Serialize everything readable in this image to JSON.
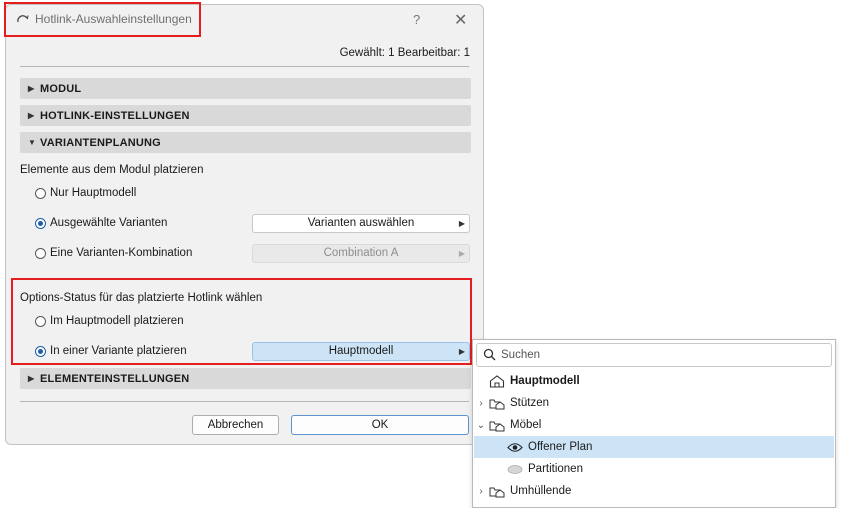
{
  "dialog": {
    "title": "Hotlink-Auswahleinstellungen",
    "help": "?",
    "close": "✕",
    "selection_status": "Gewählt: 1 Bearbeitbar: 1",
    "sections": {
      "modul": "MODUL",
      "hotlink_settings": "HOTLINK-EINSTELLUNGEN",
      "variant_planning": "VARIANTENPLANUNG",
      "element_settings": "ELEMENTEINSTELLUNGEN"
    },
    "place_elements": {
      "label": "Elemente aus dem Modul platzieren",
      "options": [
        {
          "label": "Nur Hauptmodell",
          "selected": false
        },
        {
          "label": "Ausgewählte Varianten",
          "selected": true,
          "button": "Varianten auswählen"
        },
        {
          "label": "Eine Varianten-Kombination",
          "selected": false,
          "button": "Combination A"
        }
      ]
    },
    "options_status": {
      "label": "Options-Status für das platzierte Hotlink wählen",
      "options": [
        {
          "label": "Im Hauptmodell platzieren",
          "selected": false
        },
        {
          "label": "In einer Variante platzieren",
          "selected": true,
          "button": "Hauptmodell"
        }
      ]
    },
    "buttons": {
      "cancel": "Abbrechen",
      "ok": "OK"
    }
  },
  "dropdown": {
    "search_placeholder": "Suchen",
    "items": [
      {
        "label": "Hauptmodell",
        "icon": "house-icon",
        "bold": true
      },
      {
        "label": "Stützen",
        "icon": "variant-set-icon",
        "expanded": false
      },
      {
        "label": "Möbel",
        "icon": "variant-set-icon",
        "expanded": true
      },
      {
        "label": "Offener Plan",
        "icon": "eye-icon",
        "selected": true
      },
      {
        "label": "Partitionen",
        "icon": "hidden-eye-icon"
      },
      {
        "label": "Umhüllende",
        "icon": "variant-set-icon",
        "expanded": false
      }
    ]
  },
  "colors": {
    "highlight": "#e41e1e",
    "selection": "#cde4f7",
    "accent": "#1d5ea8"
  }
}
